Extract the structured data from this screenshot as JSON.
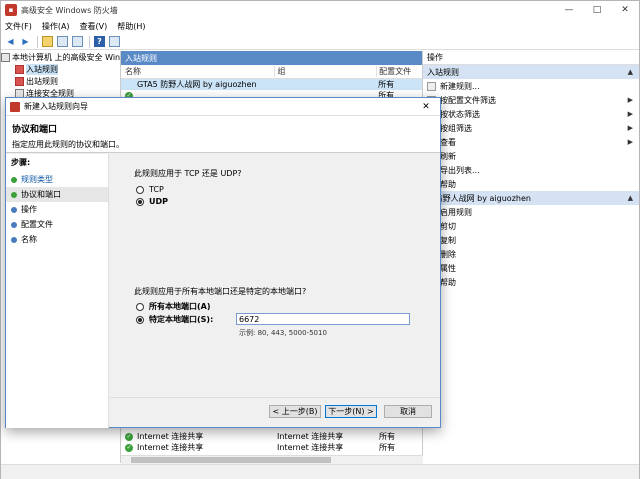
{
  "window": {
    "title": "高级安全 Windows 防火墙",
    "controls": [
      "—",
      "□",
      "✕"
    ]
  },
  "menu": [
    "文件(F)",
    "操作(A)",
    "查看(V)",
    "帮助(H)"
  ],
  "tree": {
    "items": [
      {
        "label": "本地计算机 上的高级安全 Win"
      },
      {
        "label": "入站规则",
        "selected": true
      },
      {
        "label": "出站规则"
      },
      {
        "label": "连接安全规则"
      }
    ]
  },
  "center": {
    "header": "入站规则",
    "columns": {
      "name": "名称",
      "group": "组",
      "profile": "配置文件"
    },
    "rows_top": [
      {
        "name": "GTA5 防野人战网 by aiguozhen",
        "group": "",
        "profile": "所有",
        "check": false,
        "selected": true
      },
      {
        "name": "",
        "group": "",
        "profile": "所有",
        "check": true
      }
    ],
    "rows_bottom": [
      {
        "name": "Internet 连接共享",
        "group": "Internet 连接共享",
        "profile": "所有"
      },
      {
        "name": "Internet 连接共享",
        "group": "Internet 连接共享",
        "profile": "所有"
      }
    ]
  },
  "actions": {
    "title": "操作",
    "section1": "入站规则",
    "items1": [
      {
        "label": "新建规则...",
        "arrow": false
      },
      {
        "label": "按配置文件筛选",
        "arrow": true
      },
      {
        "label": "按状态筛选",
        "arrow": true
      },
      {
        "label": "按组筛选",
        "arrow": true
      },
      {
        "label": "查看",
        "arrow": true
      },
      {
        "label": "刷新",
        "arrow": false
      },
      {
        "label": "导出列表...",
        "arrow": false
      },
      {
        "label": "帮助",
        "arrow": false
      }
    ],
    "section2": "5 防野人战网 by aiguozhen",
    "items2": [
      {
        "label": "启用规则"
      },
      {
        "label": "剪切"
      },
      {
        "label": "复制"
      },
      {
        "label": "删除"
      },
      {
        "label": "属性"
      },
      {
        "label": "帮助"
      }
    ]
  },
  "wizard": {
    "title": "新建入站规则向导",
    "heading": "协议和端口",
    "subheading": "指定应用此规则的协议和端口。",
    "steps_title": "步骤:",
    "steps": [
      {
        "label": "规则类型",
        "dot": "green",
        "link": true
      },
      {
        "label": "协议和端口",
        "dot": "green",
        "current": true
      },
      {
        "label": "操作",
        "dot": "blue"
      },
      {
        "label": "配置文件",
        "dot": "blue"
      },
      {
        "label": "名称",
        "dot": "blue"
      }
    ],
    "q_protocol": "此规则应用于 TCP 还是 UDP?",
    "opt_tcp": "TCP",
    "opt_udp": "UDP",
    "q_ports": "此规则应用于所有本地端口还是特定的本地端口?",
    "opt_all_ports": "所有本地端口(A)",
    "opt_specific_ports": "特定本地端口(S):",
    "port_value": "6672",
    "example": "示例: 80, 443, 5000-5010",
    "btn_back": "< 上一步(B)",
    "btn_next": "下一步(N) >",
    "btn_cancel": "取消"
  }
}
